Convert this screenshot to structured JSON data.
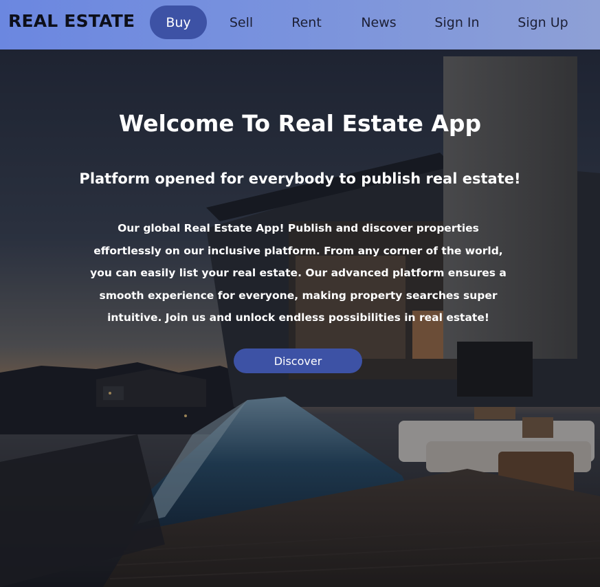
{
  "brand": {
    "title": "REAL ESTATE"
  },
  "nav": {
    "items": [
      {
        "label": "Buy",
        "active": true
      },
      {
        "label": "Sell",
        "active": false
      },
      {
        "label": "Rent",
        "active": false
      },
      {
        "label": "News",
        "active": false
      },
      {
        "label": "Sign In",
        "active": false
      },
      {
        "label": "Sign Up",
        "active": false
      }
    ]
  },
  "hero": {
    "title": "Welcome To Real Estate App",
    "subtitle": "Platform opened for everybody to publish real estate!",
    "description": "Our global Real Estate App! Publish and discover properties effortlessly on our inclusive platform. From any corner of the world, you can easily list your real estate. Our advanced platform ensures a smooth experience for everyone, making property searches super intuitive. Join us and unlock endless possibilities in real estate!",
    "cta_label": "Discover"
  },
  "colors": {
    "navbar_gradient_start": "#6b87e0",
    "navbar_gradient_end": "#8ea0d6",
    "accent": "#3d52a5",
    "hero_text": "#ffffff"
  },
  "icons": []
}
